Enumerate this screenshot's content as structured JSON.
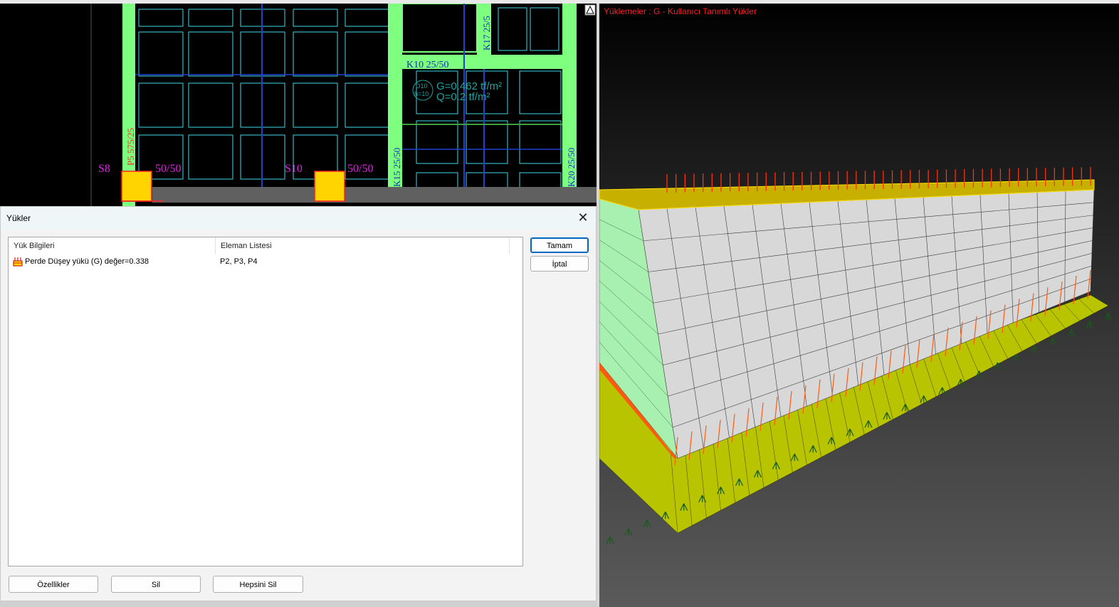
{
  "cad": {
    "labels": {
      "beam_k10": "K10 25/50",
      "beam_k17": "K17 25/5",
      "beam_k15": "K15 25/50",
      "beam_k20": "K20 25/50",
      "wall_p5": "P5 575/25",
      "col_s8": "S8",
      "col_s8_size": "50/50",
      "col_s10": "S10",
      "col_s10_size": "50/50",
      "slab_id": "D10",
      "slab_thk": "h=10",
      "load_g": "G=0.462 tf/m²",
      "load_q": "Q=0.2 tf/m²"
    }
  },
  "view3d": {
    "title": "Yüklemeler : G - Kullanıcı Tanımlı Yükler"
  },
  "dialog": {
    "title": "Yükler",
    "close_glyph": "✕",
    "columns": [
      "Yük Bilgileri",
      "Eleman Listesi"
    ],
    "rows": [
      {
        "info": "Perde Düşey yükü (G) değer=0.338",
        "elements": "P2, P3, P4"
      }
    ],
    "buttons": {
      "ok": "Tamam",
      "cancel": "İptal",
      "properties": "Özellikler",
      "delete": "Sil",
      "delete_all": "Hepsini Sil"
    }
  },
  "colors": {
    "cad_bg": "#000000",
    "beam_fill": "#7fff7f",
    "slab_line": "#40d8e8",
    "axis_line": "#2040d0",
    "column_fill": "#ffd400",
    "label_magenta": "#e020e0",
    "label_red": "#ff2020",
    "wall_face": "#d8d8d8",
    "foundation": "#b8c400",
    "load_arrow": "#ff4010"
  }
}
